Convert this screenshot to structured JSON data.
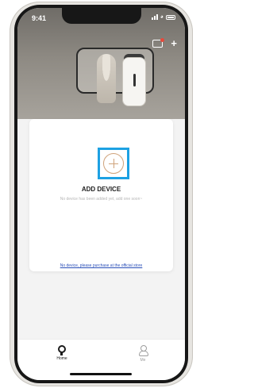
{
  "status_bar": {
    "time": "9:41"
  },
  "header": {
    "icons": [
      "message-icon",
      "plus-icon"
    ],
    "add_symbol": "+"
  },
  "empty_state": {
    "title": "ADD DEVICE",
    "subtitle": "No device has been added yet, add one soon~",
    "link": "No device, please purchase at the official store"
  },
  "tabbar": {
    "home_label": "Home",
    "me_label": "Me"
  },
  "colors": {
    "highlight_border": "#1da1e3",
    "accent": "#cfa27a",
    "link": "#2a4fb8"
  }
}
